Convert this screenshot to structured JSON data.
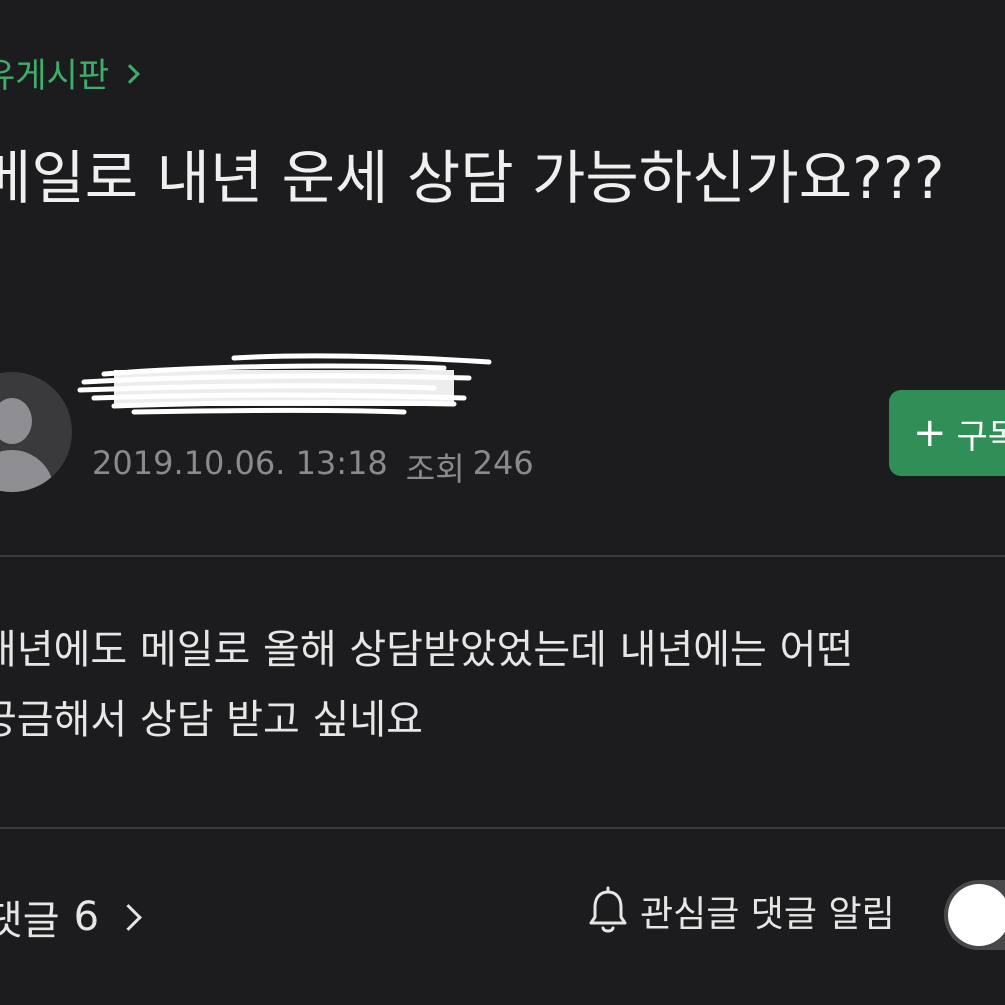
{
  "board": {
    "name": "유게시판",
    "chevron_icon": "chevron-right-icon"
  },
  "post": {
    "title": "메일로 내년 운세 상담 가능하신가요???",
    "date": "2019.10.06. 13:18",
    "views_label": "조회",
    "views": "246",
    "body_lines": [
      "내년에도 메일로 올해 상담받았었는데 내년에는 어떤",
      "궁금해서 상담 받고 싶네요"
    ]
  },
  "author": {
    "nickname": "",
    "avatar_icon": "default-avatar-icon"
  },
  "subscribe": {
    "icon": "plus-icon",
    "label": "구독"
  },
  "footer": {
    "comments_label": "댓글",
    "comments_count": "6",
    "notify_label": "관심글 댓글 알림",
    "notify_enabled": false
  },
  "colors": {
    "background": "#1c1c1e",
    "accent": "#3fae6a",
    "button": "#2f8f57",
    "muted": "#8a8a8e"
  }
}
